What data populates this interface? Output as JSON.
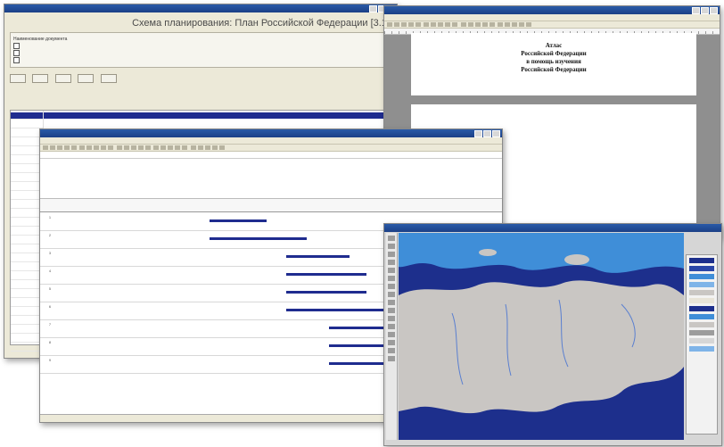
{
  "planning_window": {
    "title": "Схема планирования: План Российской Федерации [3.1]",
    "options_header": "Наименование документа",
    "options": [
      "",
      "",
      ""
    ],
    "buttons": [
      "",
      "",
      "",
      "",
      ""
    ],
    "tree_selected": "",
    "tree_nodes": [
      "",
      ""
    ]
  },
  "doc_window": {
    "cover_lines": [
      "Атлас",
      "Российской Федерации",
      "в помощь изучения",
      "Российской Федерации"
    ],
    "body_lines": []
  },
  "gantt_window": {
    "sheet_title": "",
    "rows": [
      {
        "num": "1",
        "bar_start": 0.0,
        "bar_len": 0.2
      },
      {
        "num": "2",
        "bar_start": 0.0,
        "bar_len": 0.34
      },
      {
        "num": "3",
        "bar_start": 0.27,
        "bar_len": 0.22
      },
      {
        "num": "4",
        "bar_start": 0.27,
        "bar_len": 0.28
      },
      {
        "num": "5",
        "bar_start": 0.27,
        "bar_len": 0.28
      },
      {
        "num": "6",
        "bar_start": 0.27,
        "bar_len": 0.55
      },
      {
        "num": "7",
        "bar_start": 0.42,
        "bar_len": 0.3
      },
      {
        "num": "8",
        "bar_start": 0.42,
        "bar_len": 0.3
      },
      {
        "num": "9",
        "bar_start": 0.42,
        "bar_len": 0.22
      }
    ]
  },
  "colors": {
    "accent_blue": "#1f2c8f",
    "ocean_deep": "#1d2f8c",
    "ocean_light": "#3f8ed8",
    "land": "#c9c6c3"
  }
}
